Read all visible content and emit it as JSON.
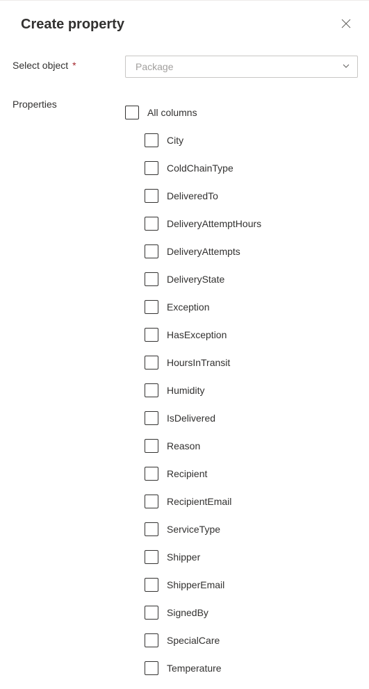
{
  "header": {
    "title": "Create property"
  },
  "selectObject": {
    "label": "Select object",
    "required": "*",
    "placeholder": "Package"
  },
  "properties": {
    "label": "Properties",
    "allColumns": "All columns",
    "items": [
      "City",
      "ColdChainType",
      "DeliveredTo",
      "DeliveryAttemptHours",
      "DeliveryAttempts",
      "DeliveryState",
      "Exception",
      "HasException",
      "HoursInTransit",
      "Humidity",
      "IsDelivered",
      "Reason",
      "Recipient",
      "RecipientEmail",
      "ServiceType",
      "Shipper",
      "ShipperEmail",
      "SignedBy",
      "SpecialCare",
      "Temperature"
    ]
  }
}
